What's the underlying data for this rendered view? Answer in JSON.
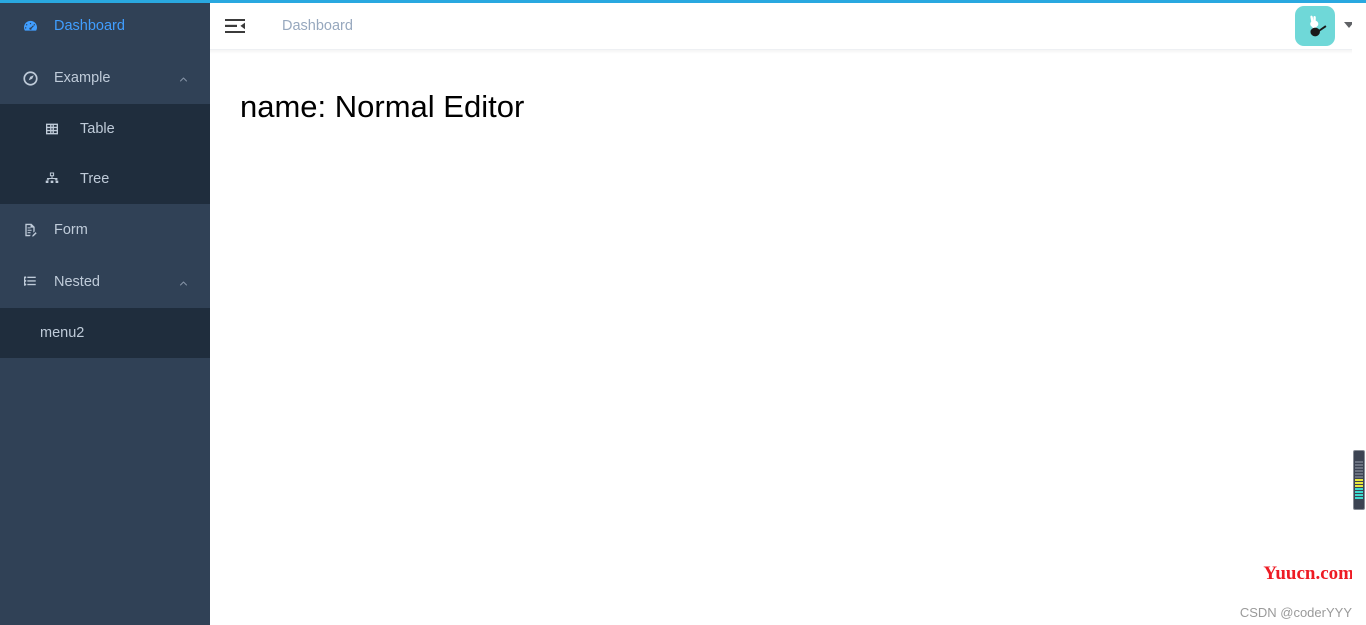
{
  "app": {
    "accent_blue": "#409eff",
    "progress_bar_color": "#29a8e0",
    "sidebar_bg": "#304156",
    "submenu_bg": "#1f2d3d",
    "avatar_bg": "#6fd8d8"
  },
  "sidebar": {
    "items": [
      {
        "label": "Dashboard",
        "icon": "dashboard-icon",
        "active": true
      },
      {
        "label": "Example",
        "icon": "compass-icon",
        "expandable": true,
        "expanded": true
      },
      {
        "label": "Table",
        "icon": "grid-icon",
        "child": true
      },
      {
        "label": "Tree",
        "icon": "sitemap-icon",
        "child": true
      },
      {
        "label": "Form",
        "icon": "form-document-icon"
      },
      {
        "label": "Nested",
        "icon": "nested-list-icon",
        "expandable": true,
        "expanded": true
      },
      {
        "label": "menu2",
        "icon": "none",
        "child": true
      }
    ]
  },
  "header": {
    "hamburger_icon": "hamburger-collapse-icon",
    "breadcrumb": "Dashboard",
    "avatar_icon": "rabbit-avatar-icon",
    "caret_icon": "caret-down-icon"
  },
  "main": {
    "heading": "name: Normal Editor"
  },
  "watermark": {
    "primary": "Yuucn.com",
    "secondary": "CSDN @coderYYY"
  },
  "scrollbar": {
    "orientation": "vertical",
    "thumb_position_pct": 76
  }
}
